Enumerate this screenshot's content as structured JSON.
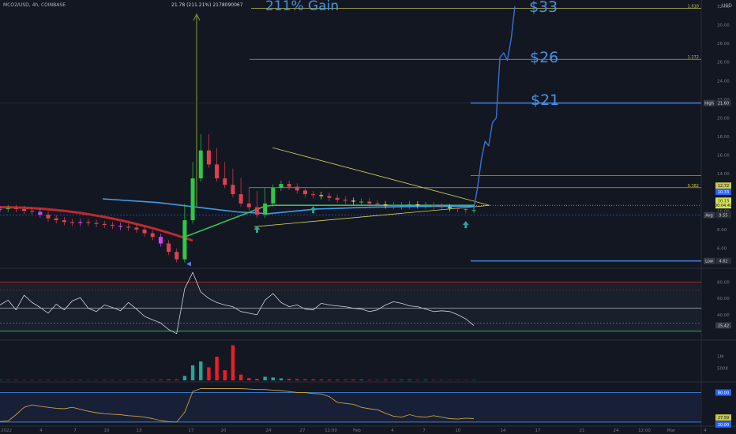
{
  "header": {
    "symbol": "MCO2/USD, 4h, COINBASE",
    "measure": "21.78 (211.21%) 2178090067",
    "currency": "USD"
  },
  "annotations": [
    {
      "id": "gain",
      "text": "211% Gain"
    },
    {
      "id": "t33",
      "text": "$33"
    },
    {
      "id": "t26",
      "text": "$26"
    },
    {
      "id": "t21",
      "text": "$21"
    }
  ],
  "fib_labels": [
    {
      "text": "1.618",
      "price": 31.8
    },
    {
      "text": "1.272",
      "price": 26.3
    },
    {
      "text": "0.382",
      "price": 12.5
    }
  ],
  "price_tags": [
    {
      "text": "High",
      "value": "21.60",
      "price": 21.6,
      "kind": "label"
    },
    {
      "text": "",
      "value": "12.72",
      "price": 12.72,
      "kind": "green"
    },
    {
      "text": "",
      "value": "10.33",
      "price": 12.05,
      "kind": "blue"
    },
    {
      "text": "",
      "value": "10.13",
      "price": 11.1,
      "kind": "yellow"
    },
    {
      "text": "",
      "value": "00:04:49",
      "price": 10.6,
      "kind": "yellow"
    },
    {
      "text": "Avg",
      "value": "9.55",
      "price": 9.55,
      "kind": "label"
    },
    {
      "text": "Low",
      "value": "4.62",
      "price": 4.62,
      "kind": "label"
    }
  ],
  "rsi_tag": "25.42",
  "vol_axis": [
    "1M",
    "500K"
  ],
  "stoch_tags": [
    "80.00",
    "27.59",
    "20.00"
  ],
  "colors": {
    "bg": "#131722",
    "up": "#26a69a",
    "down": "#ef5350",
    "accent": "#2962ff",
    "fib": "#c8c84a",
    "tri": "#d4d45a"
  },
  "chart_data": [
    {
      "type": "line",
      "panel": "price",
      "ylim": [
        4,
        32
      ],
      "y_ticks": [
        6,
        8,
        10,
        12,
        14,
        16,
        18,
        20,
        22,
        24,
        26,
        28,
        30,
        32
      ],
      "x_labels": [
        "2022",
        "4",
        "7",
        "10",
        "13",
        "17",
        "20",
        "24",
        "27",
        "12:00",
        "Feb",
        "4",
        "7",
        "10",
        "14",
        "17",
        "21",
        "24",
        "12:00",
        "Mar",
        "4"
      ],
      "series": [
        {
          "values": [
            10.2,
            10.3,
            10.2,
            10.0,
            9.9,
            9.6,
            9.2,
            9.0,
            8.8,
            8.7,
            8.8,
            8.7,
            8.6,
            8.5,
            8.4,
            8.3,
            8.2,
            8.0,
            7.6,
            7.2,
            6.5,
            5.6,
            4.8,
            9.0,
            13.5,
            16.5,
            15.0,
            13.5,
            12.8,
            11.8,
            10.8,
            10.4,
            9.6,
            10.8,
            12.5,
            12.9,
            12.6,
            12.2,
            11.8,
            11.7,
            11.6,
            11.4,
            11.2,
            11.1,
            11.0,
            11.0,
            10.8,
            10.7,
            10.6,
            10.5,
            10.6,
            10.7,
            10.6,
            10.6,
            10.5,
            10.4,
            10.3,
            10.2,
            10.1,
            10.1
          ]
        }
      ],
      "forecast": [
        10.2,
        12.5,
        15.5,
        17.5,
        17.0,
        19.5,
        20.0,
        26.5,
        27.0,
        26.2,
        28.5,
        32.0
      ],
      "levels": [
        31.8,
        26.3,
        21.6,
        13.8,
        12.5,
        4.62
      ],
      "arrows": [
        {
          "kind": "down-blue",
          "index": 23
        },
        {
          "kind": "up-teal",
          "index": 32
        },
        {
          "kind": "up-teal",
          "index": 39
        },
        {
          "kind": "up-teal",
          "index": 58
        }
      ]
    },
    {
      "type": "line",
      "panel": "rsi",
      "ylim": [
        10,
        95
      ],
      "y_ticks": [
        40,
        60,
        80
      ],
      "levels": [
        80,
        70,
        30,
        20
      ],
      "values": [
        52,
        58,
        46,
        64,
        55,
        49,
        42,
        53,
        46,
        57,
        61,
        48,
        44,
        52,
        49,
        45,
        55,
        47,
        38,
        34,
        30,
        22,
        17,
        72,
        92,
        68,
        60,
        55,
        52,
        50,
        44,
        42,
        40,
        58,
        66,
        55,
        50,
        52,
        47,
        46,
        54,
        52,
        51,
        50,
        48,
        47,
        44,
        46,
        52,
        56,
        54,
        51,
        50,
        47,
        44,
        45,
        44,
        40,
        35,
        27
      ]
    },
    {
      "type": "bar",
      "panel": "volume",
      "ylim": [
        0,
        1600000
      ],
      "y_ticks": [
        500000,
        1000000
      ],
      "values": [
        15000,
        12000,
        14000,
        10000,
        11000,
        12000,
        13000,
        10000,
        9000,
        12000,
        11000,
        10000,
        10000,
        14000,
        12000,
        11000,
        13000,
        12000,
        15000,
        20000,
        25000,
        40000,
        35000,
        180000,
        620000,
        780000,
        540000,
        980000,
        420000,
        1450000,
        240000,
        90000,
        60000,
        150000,
        120000,
        80000,
        60000,
        50000,
        40000,
        40000,
        35000,
        30000,
        30000,
        25000,
        30000,
        25000,
        20000,
        18000,
        22000,
        20000,
        18000,
        18000,
        16000,
        15000,
        15000,
        14000,
        13000,
        13000,
        12000,
        11000
      ]
    },
    {
      "type": "line",
      "panel": "stoch",
      "ylim": [
        15,
        100
      ],
      "levels": [
        80,
        20
      ],
      "values": [
        21,
        22,
        35,
        50,
        55,
        52,
        50,
        48,
        47,
        50,
        46,
        42,
        39,
        37,
        36,
        35,
        33,
        32,
        30,
        27,
        23,
        21,
        20,
        40,
        82,
        88,
        88,
        88,
        88,
        88,
        88,
        87,
        86,
        86,
        85,
        84,
        82,
        80,
        80,
        78,
        77,
        72,
        60,
        58,
        56,
        50,
        47,
        45,
        38,
        32,
        30,
        35,
        31,
        30,
        33,
        30,
        27,
        26,
        28,
        27
      ]
    }
  ]
}
